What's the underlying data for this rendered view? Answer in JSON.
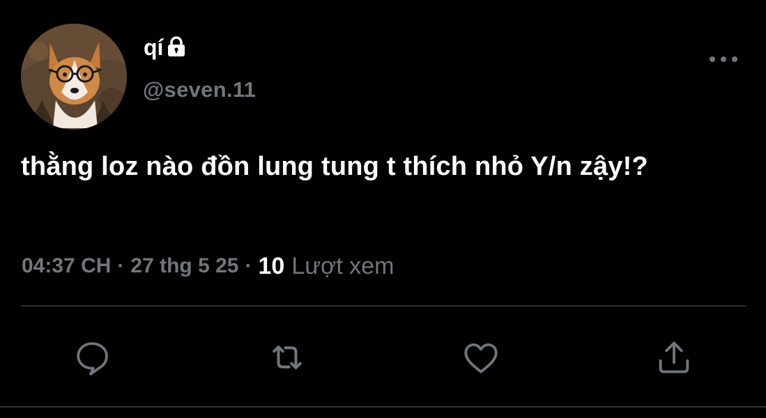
{
  "user": {
    "display_name": "qí",
    "handle": "@seven.11",
    "avatar_icon": "corgi-with-glasses-avatar",
    "protected_icon": "lock-icon"
  },
  "tweet": {
    "text": "thằng loz nào đồn lung tung t thích nhỏ Y/n zậy!?",
    "time": "04:37 CH",
    "date": "27 thg 5 25",
    "separator": "·",
    "views_count": "10",
    "views_label": "Lượt xem"
  },
  "actions": [
    {
      "name": "reply",
      "icon": "reply-icon"
    },
    {
      "name": "retweet",
      "icon": "retweet-icon"
    },
    {
      "name": "like",
      "icon": "heart-icon"
    },
    {
      "name": "share",
      "icon": "share-icon"
    }
  ],
  "colors": {
    "background": "#000000",
    "primary_text": "#ffffff",
    "secondary_text": "#71767b",
    "divider": "#2f3336"
  }
}
